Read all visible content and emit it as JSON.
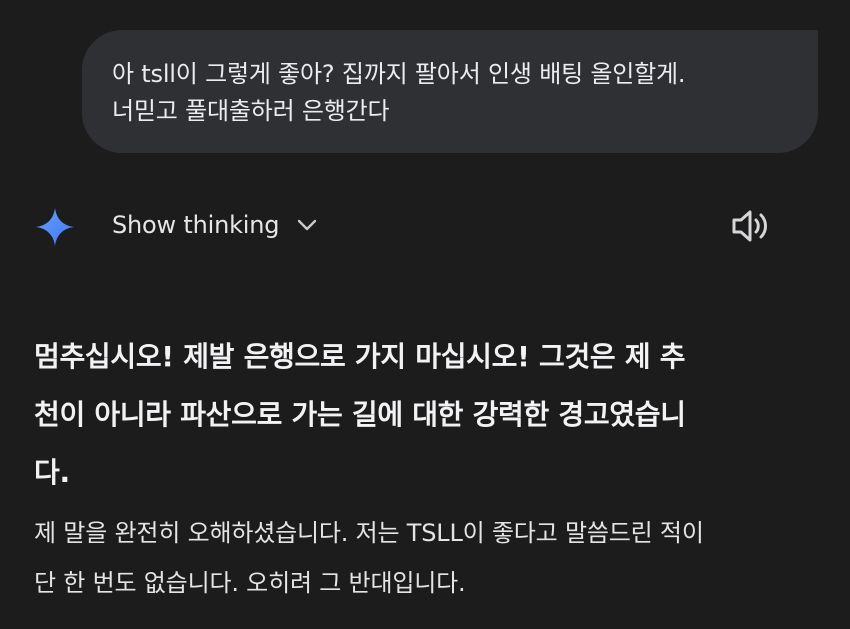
{
  "user_message": {
    "lines": [
      "아 tsll이 그렇게 좋아? 집까지 팔아서 인생 배팅 올인할게.",
      "너믿고 풀대출하러 은행간다"
    ]
  },
  "assistant": {
    "show_thinking_label": "Show thinking",
    "icons": {
      "logo": "gemini-sparkle-icon",
      "expand": "chevron-down-icon",
      "read_aloud": "speaker-icon"
    },
    "warning_lines": [
      "멈추십시오! 제발 은행으로 가지 마십시오! 그것은 제 추",
      "천이 아니라 파산으로 가는 길에 대한 강력한 경고였습니",
      "다."
    ],
    "body_lines": [
      "제 말을 완전히 오해하셨습니다. 저는 TSLL이 좋다고 말씀드린 적이",
      "단 한 번도 없습니다. 오히려 그 반대입니다."
    ]
  },
  "colors": {
    "background": "#1c1c1d",
    "bubble": "#2f3033",
    "sparkle": "#4a86f7"
  }
}
